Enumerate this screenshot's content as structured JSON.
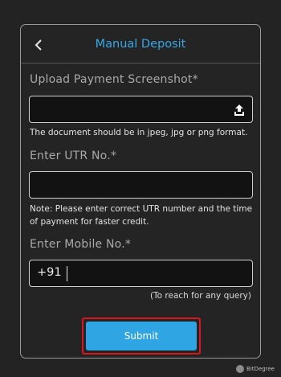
{
  "header": {
    "title": "Manual Deposit",
    "back_icon": "chevron-left-icon"
  },
  "upload": {
    "label": "Upload Payment Screenshot*",
    "icon": "upload-icon",
    "hint": "The document should be in jpeg, jpg or png format."
  },
  "utr": {
    "label": "Enter UTR No.*",
    "value": "",
    "hint_line1": "Note: Please enter correct UTR number and the time",
    "hint_line2": "of payment for faster credit."
  },
  "mobile": {
    "label": "Enter Mobile No.*",
    "prefix": "+91",
    "value": "",
    "hint": "(To reach for any query)"
  },
  "submit": {
    "label": "Submit"
  },
  "watermark": {
    "text": "BitDegree"
  },
  "colors": {
    "accent": "#37a7e6",
    "button": "#2fa6e3",
    "highlight": "#d7191f",
    "background": "#232323"
  }
}
